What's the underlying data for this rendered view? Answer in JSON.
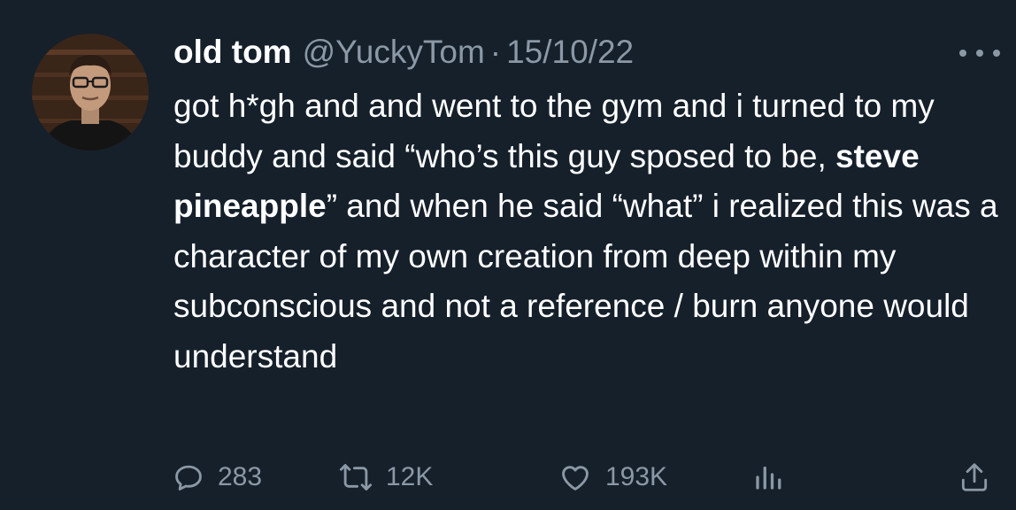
{
  "tweet": {
    "display_name": "old tom",
    "handle": "@YuckyTom",
    "separator": "·",
    "date": "15/10/22",
    "text": {
      "part1": "got h*gh and and went to the gym and i turned to my buddy and said “who’s this guy sposed to be, ",
      "bold": "steve pineapple",
      "part2": "” and when he said “what” i realized this was a character of my own creation from deep within my subconscious and not a reference / burn anyone would understand"
    },
    "stats": {
      "replies": "283",
      "retweets": "12K",
      "likes": "193K"
    }
  },
  "icons": {
    "more": "more-horizontal-icon",
    "reply": "reply-bubble-icon",
    "retweet": "retweet-icon",
    "like": "heart-icon",
    "views": "views-chart-icon",
    "share": "share-icon"
  },
  "colors": {
    "background": "#15202b",
    "primary_text": "#ffffff",
    "secondary_text": "#8b98a5"
  }
}
